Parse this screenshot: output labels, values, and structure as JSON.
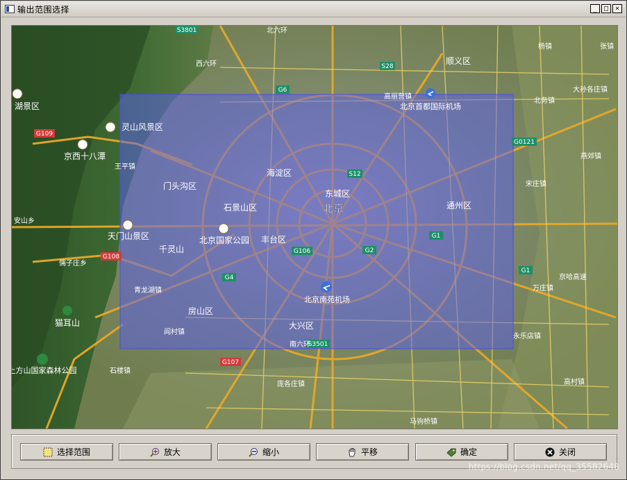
{
  "window": {
    "title": "输出范围选择",
    "minimize": "_",
    "maximize": "□",
    "close": "×"
  },
  "map": {
    "labels": {
      "beijing": "北京",
      "dongcheng": "东城区",
      "haidian": "海淀区",
      "shijingshan": "石景山区",
      "fengtai": "丰台区",
      "mentougou": "门头沟区",
      "tongzhou": "通州区",
      "daxing": "大兴区",
      "fangshan": "房山区",
      "shunyi": "顺义区",
      "capital_airport": "北京首都国际机场",
      "nanyuan_airport": "北京南苑机场",
      "lingshan": "灵山风景区",
      "jingxi": "京西十八潭",
      "wangping": "王平镇",
      "tianmenshan": "天门山景区",
      "qianlingshan": "千灵山",
      "national_park": "北京国家公园",
      "qinglongshan": "青龙湖镇",
      "yancun": "阎村镇",
      "shangfang": "上方山国家森林公园",
      "maoershan": "猫耳山",
      "shilou": "石楼镇",
      "panggezhuang": "庞各庄镇",
      "gaoliying": "高丽营镇",
      "yangzhen": "杨镇",
      "zhangzhen": "张镇",
      "dasungezhuang": "大孙各庄镇",
      "beiwu": "北务镇",
      "songzhuang": "宋庄镇",
      "yongledian": "永乐店镇",
      "gaocun": "高村镇",
      "majuqiao": "马驹桥镇",
      "wanzhuang": "万庄镇",
      "yanqiao": "燕郊镇",
      "lize": "京哈高速",
      "hujiabao": "湖景区",
      "shanyang": "安山乡",
      "qiangzi": "儒子庄乡",
      "beiliuhuan": "北六环",
      "xiliuhuan": "西六环",
      "nanliuhuan": "南六环"
    },
    "route_shields": [
      "S3801",
      "S28",
      "G6",
      "S12",
      "G1",
      "G2",
      "G106",
      "G4",
      "S3501",
      "G107",
      "G108",
      "G109",
      "G0121",
      "G1"
    ],
    "selection_color": "#5a5ef0"
  },
  "toolbar": {
    "select_range": "选择范围",
    "zoom_in": "放大",
    "zoom_out": "缩小",
    "pan": "平移",
    "confirm": "确定",
    "close": "关闭"
  },
  "watermark": "https://blog.csdn.net/qq_35582648"
}
